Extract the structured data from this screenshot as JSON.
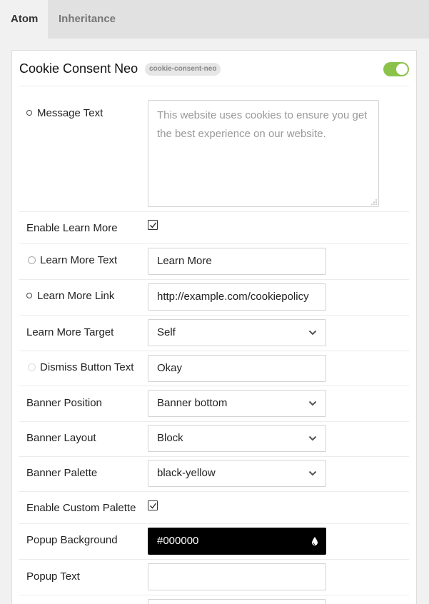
{
  "tabs": [
    {
      "label": "Atom",
      "active": true
    },
    {
      "label": "Inheritance",
      "active": false
    }
  ],
  "header": {
    "title": "Cookie Consent Neo",
    "slug": "cookie-consent-neo",
    "enabled": true,
    "toggle_color": "#8bc34a"
  },
  "fields": {
    "message_text": {
      "label": "Message Text",
      "placeholder": "This website uses cookies to ensure you get the best experience on our website."
    },
    "enable_learn_more": {
      "label": "Enable Learn More",
      "checked": true
    },
    "learn_more_text": {
      "label": "Learn More Text",
      "value": "Learn More"
    },
    "learn_more_link": {
      "label": "Learn More Link",
      "value": "http://example.com/cookiepolicy"
    },
    "learn_more_target": {
      "label": "Learn More Target",
      "value": "Self"
    },
    "dismiss_button_text": {
      "label": "Dismiss Button Text",
      "value": "Okay"
    },
    "banner_position": {
      "label": "Banner Position",
      "value": "Banner bottom"
    },
    "banner_layout": {
      "label": "Banner Layout",
      "value": "Block"
    },
    "banner_palette": {
      "label": "Banner Palette",
      "value": "black-yellow"
    },
    "enable_custom_palette": {
      "label": "Enable Custom Palette",
      "checked": true
    },
    "popup_background": {
      "label": "Popup Background",
      "value": "#000000",
      "swatch": "#000000"
    },
    "popup_text": {
      "label": "Popup Text",
      "value": ""
    }
  },
  "icons": {
    "select_chevron": "chevron-down-icon",
    "color_picker": "droplet-icon",
    "checkbox": "checkmark-icon",
    "resize": "resize-grip-icon"
  }
}
